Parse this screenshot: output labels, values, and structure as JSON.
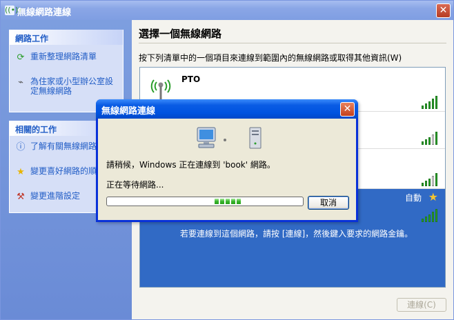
{
  "window": {
    "title": "無線網路連線",
    "close_glyph": "✕",
    "app_icon": "((•))"
  },
  "sidebar": {
    "network_tasks": {
      "header": "網路工作",
      "items": [
        {
          "label": "重新整理網路清單",
          "icon": "refresh-icon"
        },
        {
          "label": "為住家或小型辦公室設定無線網路",
          "icon": "wireless-setup-icon"
        }
      ]
    },
    "related_tasks": {
      "header": "相關的工作",
      "items": [
        {
          "label": "了解有關無線網路",
          "icon": "info-icon"
        },
        {
          "label": "變更喜好網路的順",
          "icon": "star-icon"
        },
        {
          "label": "變更進階設定",
          "icon": "settings-icon"
        }
      ]
    }
  },
  "main": {
    "heading": "選擇一個無線網路",
    "description": "按下列清單中的一個項目來連線到範圍內的無線網路或取得其他資訊(W)",
    "networks": [
      {
        "name": "PTO",
        "signal": 5
      },
      {
        "name": "",
        "signal": 4
      },
      {
        "name": "",
        "signal": 4
      },
      {
        "name": "",
        "signal": 5,
        "selected": true,
        "badge": "自動"
      }
    ],
    "selected_hint": "若要連線到這個網路，請按 [連線]，然後鍵入要求的網路金鑰。",
    "connect_button": "連線(C)"
  },
  "dialog": {
    "title": "無線網路連線",
    "close_glyph": "✕",
    "message": "請稍候，Windows 正在連線到 'book' 網路。",
    "status": "正在等待網路...",
    "progress_chunks": 5,
    "cancel_button": "取消"
  },
  "colors": {
    "selection": "#316ac5",
    "link": "#215dc6",
    "dialog_title": "#0053e0",
    "signal": "#2a9d2a"
  }
}
